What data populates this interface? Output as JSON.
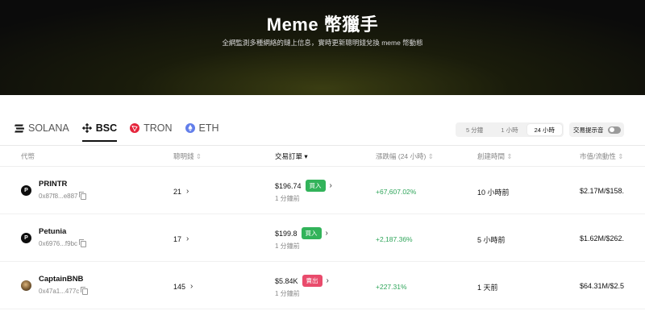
{
  "hero": {
    "title": "Meme 幣獵手",
    "subtitle": "全網監測多種網絡的鏈上信息，實時更新聰明錢兌換 meme 幣動態"
  },
  "chains": [
    {
      "label": "SOLANA",
      "icon": "solana-icon",
      "active": false
    },
    {
      "label": "BSC",
      "icon": "bsc-icon",
      "active": true
    },
    {
      "label": "TRON",
      "icon": "tron-icon",
      "active": false
    },
    {
      "label": "ETH",
      "icon": "eth-icon",
      "active": false
    }
  ],
  "timeframes": [
    {
      "label": "5 分鐘",
      "active": false
    },
    {
      "label": "1 小時",
      "active": false
    },
    {
      "label": "24 小時",
      "active": true
    }
  ],
  "alert": {
    "label": "交易提示音",
    "enabled": false
  },
  "columns": {
    "token": "代幣",
    "smart_money": "聰明錢",
    "trades": "交易訂單",
    "change": "漲跌幅 (24 小時)",
    "created": "創建時間",
    "mcap": "市值/流動性"
  },
  "rows": [
    {
      "icon_letter": "P",
      "name": "PRINTR",
      "address": "0x87f8...e887",
      "smart_money": "21",
      "price": "$196.74",
      "side": "買入",
      "side_type": "buy",
      "time": "1 分鐘前",
      "change": "+67,607.02%",
      "created": "10 小時前",
      "mcap": "$2.17M/$158."
    },
    {
      "icon_letter": "P",
      "name": "Petunia",
      "address": "0x6976...f9bc",
      "smart_money": "17",
      "price": "$199.8",
      "side": "買入",
      "side_type": "buy",
      "time": "1 分鐘前",
      "change": "+2,187.36%",
      "created": "5 小時前",
      "mcap": "$1.62M/$262."
    },
    {
      "icon_letter": "",
      "name": "CaptainBNB",
      "address": "0x47a1...477c",
      "smart_money": "145",
      "price": "$5.84K",
      "side": "賣出",
      "side_type": "sell",
      "time": "1 分鐘前",
      "change": "+227.31%",
      "created": "1 天前",
      "mcap": "$64.31M/$2.5"
    }
  ],
  "colors": {
    "buy": "#32b35a",
    "sell": "#e94b6c",
    "positive": "#2fa55a",
    "bsc": "#f0b90b",
    "tron": "#e5243b",
    "eth": "#627eea"
  }
}
